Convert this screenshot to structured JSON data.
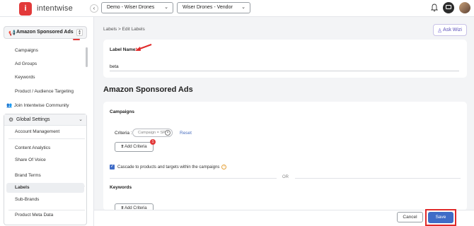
{
  "app": {
    "logo_letter": "i",
    "logo_text": "intentwise"
  },
  "header": {
    "workspace_select": "Demo - Wiser Drones",
    "account_select": "Wiser Drones - Vendor"
  },
  "sidebar": {
    "section": "Amazon Sponsored Ads",
    "items": [
      "Campaigns",
      "Ad Groups",
      "Keywords",
      "Product / Audience Targeting"
    ],
    "community": "Join Intentwise Community",
    "settings_group": "Global Settings",
    "settings_items": [
      "Account Management",
      "Content Analytics",
      "Share Of Voice",
      "Brand Terms",
      "Labels",
      "Sub-Brands",
      "Product Meta Data"
    ],
    "active_item": "Labels"
  },
  "main": {
    "breadcrumb": "Labels > Edit Labels",
    "ask_button": "Ask Wizi",
    "label_name_title": "Label Name",
    "required_mark": "*",
    "label_name_value": "beta",
    "section_title": "Amazon Sponsored Ads",
    "campaigns": {
      "title": "Campaigns",
      "criteria_label": "Criteria :",
      "criteria_chip": "Campaign = SP",
      "reset": "Reset",
      "add_criteria": "Add Criteria",
      "badge_count": "1",
      "cascade_text": "Cascade to products and targets within the campaigns",
      "or_text": "OR"
    },
    "keywords": {
      "title": "Keywords",
      "add_criteria": "Add Criteria"
    }
  },
  "footer": {
    "cancel": "Cancel",
    "save": "Save"
  },
  "colors": {
    "brand_red": "#e23a3a",
    "primary_blue": "#3f6cc7",
    "highlight_outline": "#e02a2a"
  }
}
